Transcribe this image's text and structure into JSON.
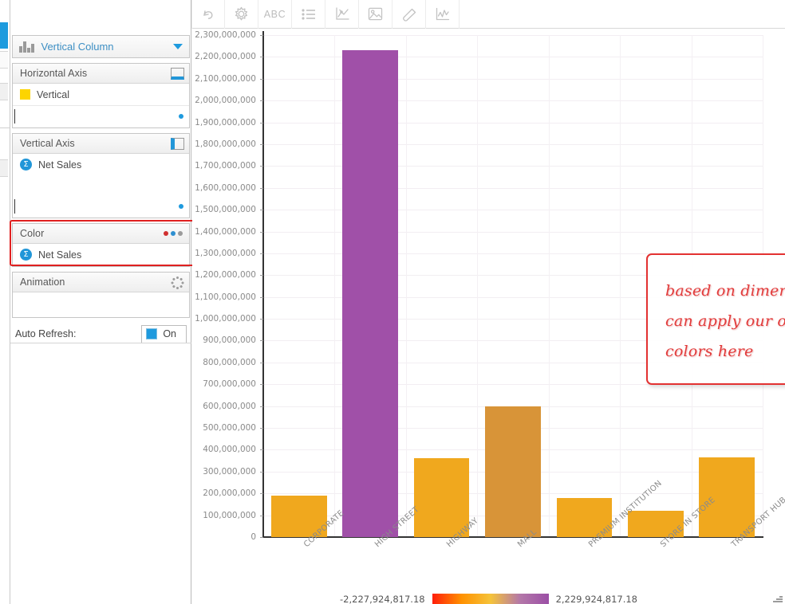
{
  "sidebar": {
    "chart_type": {
      "label": "Vertical Column",
      "icon": "bar-chart-icon",
      "chevron": "chevron-down-icon"
    },
    "panels": [
      {
        "title": "Horizontal Axis",
        "icon": "horizontal-axis-icon",
        "fields": [
          {
            "label": "Vertical",
            "icon": "yellow-swatch-icon"
          }
        ]
      },
      {
        "title": "Vertical Axis",
        "icon": "vertical-axis-icon",
        "fields": [
          {
            "label": "Net Sales",
            "icon": "sigma-measure-icon"
          }
        ]
      },
      {
        "title": "Color",
        "icon": "color-dots-icon",
        "highlighted": true,
        "fields": [
          {
            "label": "Net Sales",
            "icon": "sigma-measure-icon"
          }
        ]
      },
      {
        "title": "Animation",
        "icon": "spinner-icon",
        "fields": []
      }
    ],
    "auto_refresh": {
      "label": "Auto Refresh:",
      "state": "On",
      "checked": true
    }
  },
  "toolbar": {
    "buttons": [
      {
        "name": "undo-icon",
        "title": "Undo"
      },
      {
        "name": "gear-icon",
        "title": "Settings"
      },
      {
        "name": "abc-text-icon",
        "title": "ABC"
      },
      {
        "name": "list-icon",
        "title": "List"
      },
      {
        "name": "trend-chart-icon",
        "title": "Trend"
      },
      {
        "name": "image-icon",
        "title": "Image"
      },
      {
        "name": "tag-icon",
        "title": "Tag"
      },
      {
        "name": "line-chart-icon",
        "title": "Line Chart"
      }
    ]
  },
  "annotation": {
    "lines": [
      "based on dimension we",
      "can apply our own",
      "colors here"
    ],
    "border_color": "#e33131"
  },
  "legend": {
    "min": "-2,227,924,817.18",
    "max": "2,229,924,817.18",
    "gradient": [
      "#ff1e0a",
      "#ff9100",
      "#f5c33a",
      "#b478a8",
      "#9b4fa6"
    ]
  },
  "colors": {
    "orange": "#f0a81e",
    "purple": "#a050a8",
    "orange_dark": "#d89438",
    "accent": "#1e9ade",
    "highlight": "#e02020"
  },
  "chart_data": {
    "type": "bar",
    "title": "",
    "xlabel": "",
    "ylabel": "",
    "ylim": [
      0,
      2300000000
    ],
    "grid": true,
    "legend_position": "bottom",
    "categories": [
      "CORPORATE",
      "HIGH STREET",
      "HIGHWAY",
      "MALL",
      "PREMIUM INSTITUTION",
      "STORE IN STORE",
      "TRANSPORT HUB"
    ],
    "values": [
      190000000,
      2229924817,
      360000000,
      600000000,
      178000000,
      120000000,
      365000000
    ],
    "bar_colors": [
      "#f0a81e",
      "#a050a8",
      "#f0a81e",
      "#d89438",
      "#f0a81e",
      "#f0a81e",
      "#f0a81e"
    ],
    "ytick_labels": [
      "2,300,000,000",
      "2,200,000,000",
      "2,100,000,000",
      "2,000,000,000",
      "1,900,000,000",
      "1,800,000,000",
      "1,700,000,000",
      "1,600,000,000",
      "1,500,000,000",
      "1,400,000,000",
      "1,300,000,000",
      "1,200,000,000",
      "1,100,000,000",
      "1,000,000,000",
      "900,000,000",
      "800,000,000",
      "700,000,000",
      "600,000,000",
      "500,000,000",
      "400,000,000",
      "300,000,000",
      "200,000,000",
      "100,000,000",
      "0"
    ],
    "ytick_values": [
      2300000000,
      2200000000,
      2100000000,
      2000000000,
      1900000000,
      1800000000,
      1700000000,
      1600000000,
      1500000000,
      1400000000,
      1300000000,
      1200000000,
      1100000000,
      1000000000,
      900000000,
      800000000,
      700000000,
      600000000,
      500000000,
      400000000,
      300000000,
      200000000,
      100000000,
      0
    ]
  }
}
